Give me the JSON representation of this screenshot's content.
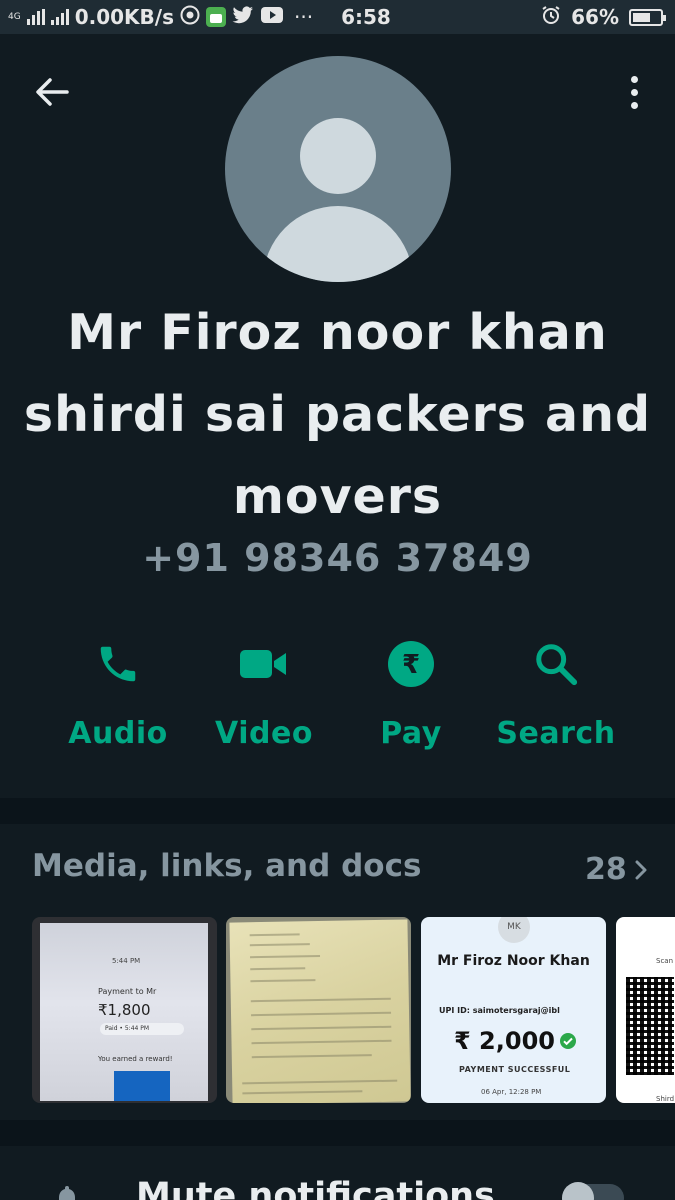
{
  "status_bar": {
    "network": "4G",
    "data_speed": "0.00KB/s",
    "dots": "···",
    "time": "6:58",
    "battery": "66%",
    "battery_level": 0.66
  },
  "header": {
    "contact_name": "Mr Firoz noor khan shirdi sai packers and movers",
    "phone": "+91 98346 37849"
  },
  "actions": [
    {
      "label": "Audio",
      "icon": "phone-icon"
    },
    {
      "label": "Video",
      "icon": "video-camera-icon"
    },
    {
      "label": "Pay",
      "icon": "rupee-icon"
    },
    {
      "label": "Search",
      "icon": "search-icon"
    }
  ],
  "media": {
    "title": "Media, links, and docs",
    "count": "28",
    "thumb1": {
      "time": "5:44 PM",
      "payment_to": "Payment to Mr",
      "amount": "₹1,800",
      "paid": "Paid • 5:44 PM",
      "reward": "You earned a reward!"
    },
    "thumb3": {
      "initials": "MK",
      "name": "Mr Firoz Noor Khan",
      "upi": "UPI ID: saimotersgaraj@ibl",
      "amount": "₹ 2,000",
      "status": "PAYMENT SUCCESSFUL",
      "date": "06 Apr, 12:28 PM"
    },
    "thumb4": {
      "scan": "Scan",
      "shirdi": "Shird"
    }
  },
  "mute": {
    "label": "Mute notifications",
    "enabled": false
  },
  "colors": {
    "accent": "#00a884",
    "background": "#111b21",
    "secondary_text": "#8696a0"
  }
}
